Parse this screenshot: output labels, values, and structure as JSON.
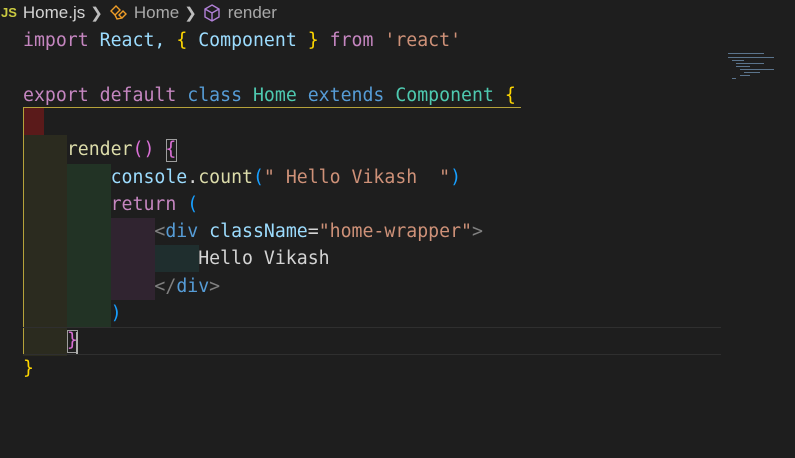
{
  "breadcrumb": {
    "lang_badge": "JS",
    "file": "Home.js",
    "class_name": "Home",
    "method_name": "render"
  },
  "code": {
    "lines": [
      {
        "tokens": [
          {
            "t": "import",
            "c": "kw2"
          },
          {
            "t": " React, ",
            "c": "var"
          },
          {
            "t": "{",
            "c": "b1"
          },
          {
            "t": " Component ",
            "c": "var"
          },
          {
            "t": "}",
            "c": "b1"
          },
          {
            "t": " from ",
            "c": "kw2"
          },
          {
            "t": "'react'",
            "c": "str"
          }
        ]
      },
      {
        "tokens": []
      },
      {
        "tokens": [
          {
            "t": "export",
            "c": "kw2"
          },
          {
            "t": " ",
            "c": "plain"
          },
          {
            "t": "default",
            "c": "kw2"
          },
          {
            "t": " ",
            "c": "plain"
          },
          {
            "t": "class",
            "c": "kw"
          },
          {
            "t": " Home ",
            "c": "cls"
          },
          {
            "t": "extends",
            "c": "kw"
          },
          {
            "t": " Component ",
            "c": "cls"
          },
          {
            "t": "{",
            "c": "b1"
          }
        ]
      },
      {
        "tokens": []
      },
      {
        "tokens": [
          {
            "t": "    ",
            "c": "plain"
          },
          {
            "t": "render",
            "c": "fn"
          },
          {
            "t": "()",
            "c": "b2"
          },
          {
            "t": " ",
            "c": "plain"
          },
          {
            "t": "{",
            "c": "b2"
          }
        ]
      },
      {
        "tokens": [
          {
            "t": "        ",
            "c": "plain"
          },
          {
            "t": "console",
            "c": "var"
          },
          {
            "t": ".",
            "c": "plain"
          },
          {
            "t": "count",
            "c": "fn"
          },
          {
            "t": "(",
            "c": "b3"
          },
          {
            "t": "\" Hello Vikash  \"",
            "c": "str"
          },
          {
            "t": ")",
            "c": "b3"
          }
        ]
      },
      {
        "tokens": [
          {
            "t": "        ",
            "c": "plain"
          },
          {
            "t": "return",
            "c": "kw2"
          },
          {
            "t": " ",
            "c": "plain"
          },
          {
            "t": "(",
            "c": "b3"
          }
        ]
      },
      {
        "tokens": [
          {
            "t": "            ",
            "c": "plain"
          },
          {
            "t": "<",
            "c": "tag"
          },
          {
            "t": "div",
            "c": "tagname"
          },
          {
            "t": " ",
            "c": "plain"
          },
          {
            "t": "className",
            "c": "attr"
          },
          {
            "t": "=",
            "c": "plain"
          },
          {
            "t": "\"home-wrapper\"",
            "c": "str"
          },
          {
            "t": ">",
            "c": "tag"
          }
        ]
      },
      {
        "tokens": [
          {
            "t": "                ",
            "c": "plain"
          },
          {
            "t": "Hello Vikash",
            "c": "plain"
          }
        ]
      },
      {
        "tokens": [
          {
            "t": "            ",
            "c": "plain"
          },
          {
            "t": "</",
            "c": "tag"
          },
          {
            "t": "div",
            "c": "tagname"
          },
          {
            "t": ">",
            "c": "tag"
          }
        ]
      },
      {
        "tokens": [
          {
            "t": "        ",
            "c": "plain"
          },
          {
            "t": ")",
            "c": "b3"
          }
        ]
      },
      {
        "tokens": [
          {
            "t": "    ",
            "c": "plain"
          },
          {
            "t": "}",
            "c": "b2"
          }
        ]
      },
      {
        "tokens": [
          {
            "t": "}",
            "c": "b1"
          }
        ]
      }
    ]
  },
  "colors": {
    "background": "#1e1e1e",
    "indent_level1": "#2b2b1f",
    "indent_level2": "#223325",
    "indent_level3": "#302430",
    "indent_level4": "#1f2e2e",
    "indent_error": "#5a1a1a"
  }
}
